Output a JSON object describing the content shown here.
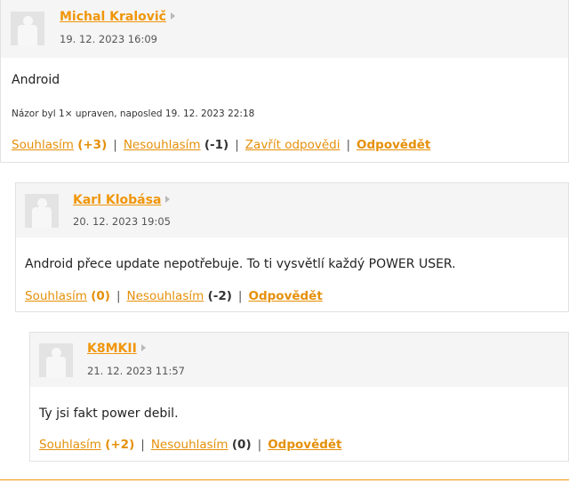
{
  "colors": {
    "accent": "#f0960a",
    "header_bg": "#f5f5f5",
    "border": "#e2e2e2"
  },
  "comments": [
    {
      "author": "Michal Kralovič",
      "date": "19. 12. 2023 16:09",
      "text": "Android",
      "edited": "Názor byl 1× upraven, naposled 19. 12. 2023 22:18",
      "agree_label": "Souhlasím",
      "agree_count": "(+3)",
      "disagree_label": "Nesouhlasím",
      "disagree_count": "(-1)",
      "close_label": "Zavřít odpovědi",
      "reply_label": "Odpovědět",
      "separator": "|"
    },
    {
      "author": "Karl Klobása",
      "date": "20. 12. 2023 19:05",
      "text": "Android přece update nepotřebuje. To ti vysvětlí každý POWER USER.",
      "agree_label": "Souhlasím",
      "agree_count": "(0)",
      "disagree_label": "Nesouhlasím",
      "disagree_count": "(-2)",
      "reply_label": "Odpovědět",
      "separator": "|"
    },
    {
      "author": "K8MKII",
      "date": "21. 12. 2023 11:57",
      "text": "Ty jsi fakt power debil.",
      "agree_label": "Souhlasím",
      "agree_count": "(+2)",
      "disagree_label": "Nesouhlasím",
      "disagree_count": "(0)",
      "reply_label": "Odpovědět",
      "separator": "|"
    }
  ]
}
